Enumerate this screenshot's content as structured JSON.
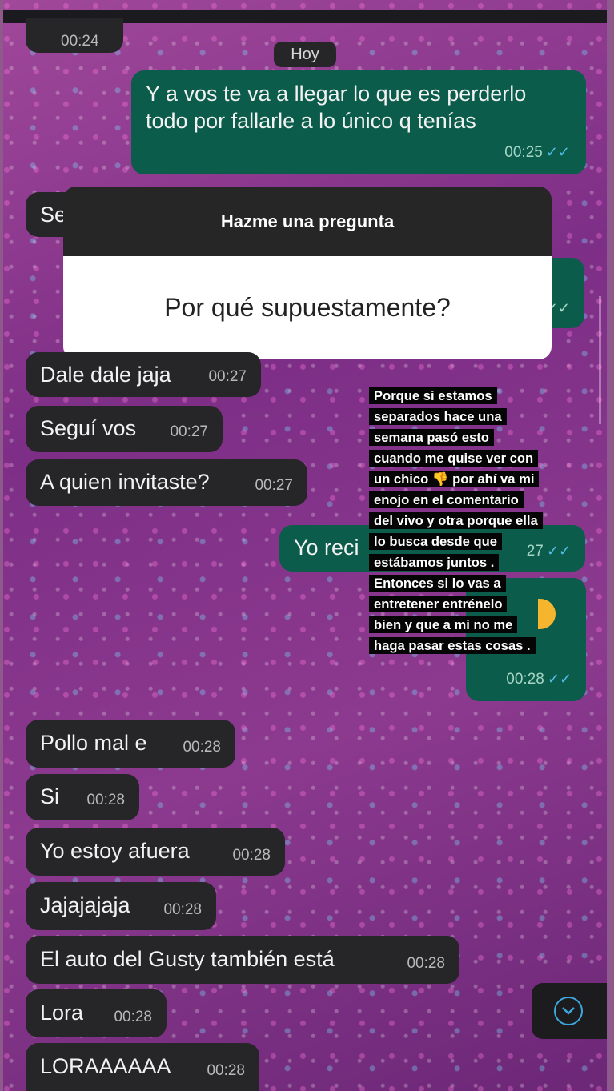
{
  "day_chip": "Hoy",
  "question_card": {
    "header": "Hazme una pregunta",
    "question": "Por qué supuestamente?"
  },
  "caption_text": [
    "Porque si estamos",
    "separados hace una",
    "semana pasó esto",
    "cuando me quise ver con",
    "un chico 👎 por ahí va mi",
    "enojo en el comentario",
    "del vivo y otra porque ella",
    "lo busca desde que",
    "estábamos juntos .",
    "Entonces si lo vas a",
    "entretener entrénelo",
    "bien y que a mi no me",
    "haga pasar estas cosas ."
  ],
  "messages": {
    "m0": {
      "time": "00:24"
    },
    "m1": {
      "text": "Y a vos te va a llegar lo que es perderlo todo por fallarle a lo único q tenías",
      "time": "00:25",
      "ticks": "✓✓"
    },
    "m2": {
      "text": "Se"
    },
    "m3": {
      "ticks": "✓✓"
    },
    "m4": {
      "text": "Dale dale jaja",
      "time": "00:27"
    },
    "m5": {
      "text": "Seguí vos",
      "time": "00:27"
    },
    "m6": {
      "text": "A quien invitaste?",
      "time": "00:27"
    },
    "m7": {
      "text": "Yo reci",
      "time": "27",
      "ticks": "✓✓"
    },
    "m8": {
      "time": "00:28",
      "ticks": "✓✓"
    },
    "m9": {
      "text": "Pollo mal e",
      "time": "00:28"
    },
    "m10": {
      "text": "Si",
      "time": "00:28"
    },
    "m11": {
      "text": "Yo estoy afuera",
      "time": "00:28"
    },
    "m12": {
      "text": "Jajajajaja",
      "time": "00:28"
    },
    "m13": {
      "text": "El auto del Gusty también está",
      "time": "00:28"
    },
    "m14": {
      "text": "Lora",
      "time": "00:28"
    },
    "m15": {
      "text": "LORAAAAAA",
      "time": "00:28"
    }
  },
  "icons": {
    "scroll_down": "chevron-down-icon",
    "read_receipt": "double-check-icon"
  },
  "colors": {
    "incoming_bubble": "#262628",
    "outgoing_bubble": "#0b5c4a",
    "read_ticks": "#53bdeb",
    "background": "#8e5a8c"
  }
}
